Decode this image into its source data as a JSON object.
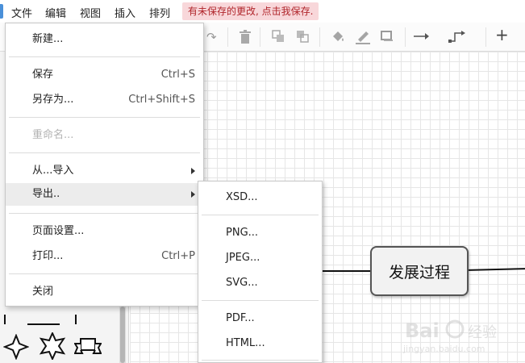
{
  "menubar": {
    "items": [
      "文件",
      "编辑",
      "视图",
      "插入",
      "排列"
    ],
    "unsaved_notice": "有未保存的更改, 点击我保存."
  },
  "toolbar": {
    "icons": [
      "redo-icon",
      "delete-icon",
      "to-front-icon",
      "to-back-icon",
      "fill-color-icon",
      "line-color-icon",
      "shadow-icon",
      "connection-icon",
      "waypoints-icon",
      "insert-icon"
    ]
  },
  "file_menu": {
    "items": [
      {
        "label": "新建...",
        "shortcut": ""
      },
      {
        "label": "保存",
        "shortcut": "Ctrl+S"
      },
      {
        "label": "另存为...",
        "shortcut": "Ctrl+Shift+S"
      },
      {
        "label": "重命名...",
        "shortcut": "",
        "disabled": true
      },
      {
        "label": "从...导入",
        "shortcut": "",
        "submenu": true
      },
      {
        "label": "导出..",
        "shortcut": "",
        "submenu": true,
        "highlighted": true
      },
      {
        "label": "页面设置...",
        "shortcut": ""
      },
      {
        "label": "打印...",
        "shortcut": "Ctrl+P"
      },
      {
        "label": "关闭",
        "shortcut": ""
      }
    ]
  },
  "export_menu": {
    "items": [
      "XSD...",
      "PNG...",
      "JPEG...",
      "SVG...",
      "PDF...",
      "HTML..."
    ]
  },
  "diagram": {
    "node_label": "发展过程"
  },
  "watermark": {
    "brand": "Bai",
    "brand_cn": "经验",
    "url": "jingyan.baidu.com"
  },
  "colors": {
    "unsaved_bg": "#f8d7da",
    "unsaved_text": "#b0252b",
    "menu_highlight": "#ececec"
  }
}
